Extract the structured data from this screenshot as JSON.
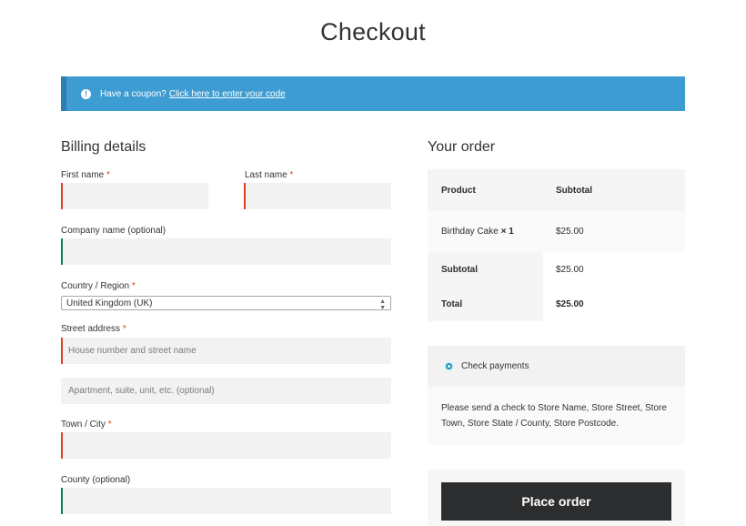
{
  "page": {
    "title": "Checkout"
  },
  "notice": {
    "text": "Have a coupon?",
    "link": "Click here to enter your code",
    "icon": "info-icon"
  },
  "billing": {
    "heading": "Billing details",
    "required_mark": "*",
    "first_name": {
      "label": "First name",
      "value": ""
    },
    "last_name": {
      "label": "Last name",
      "value": ""
    },
    "company": {
      "label": "Company name (optional)",
      "value": ""
    },
    "country": {
      "label": "Country / Region",
      "selected": "United Kingdom (UK)"
    },
    "street": {
      "label": "Street address",
      "placeholder_1": "House number and street name",
      "placeholder_2": "Apartment, suite, unit, etc. (optional)"
    },
    "city": {
      "label": "Town / City",
      "value": ""
    },
    "county": {
      "label": "County (optional)",
      "value": ""
    }
  },
  "order": {
    "heading": "Your order",
    "columns": [
      "Product",
      "Subtotal"
    ],
    "item": {
      "name": "Birthday Cake",
      "qty": "× 1",
      "subtotal": "$25.00"
    },
    "subtotal": {
      "label": "Subtotal",
      "value": "$25.00"
    },
    "total": {
      "label": "Total",
      "value": "$25.00"
    }
  },
  "payment": {
    "method": "Check payments",
    "description": "Please send a check to Store Name, Store Street, Store Town, Store State / County, Store Postcode."
  },
  "place_order_label": "Place order",
  "colors": {
    "notice_bg": "#3d9cd2",
    "required": "#e2401c",
    "valid": "#0f834d",
    "button": "#2b2d2f"
  }
}
